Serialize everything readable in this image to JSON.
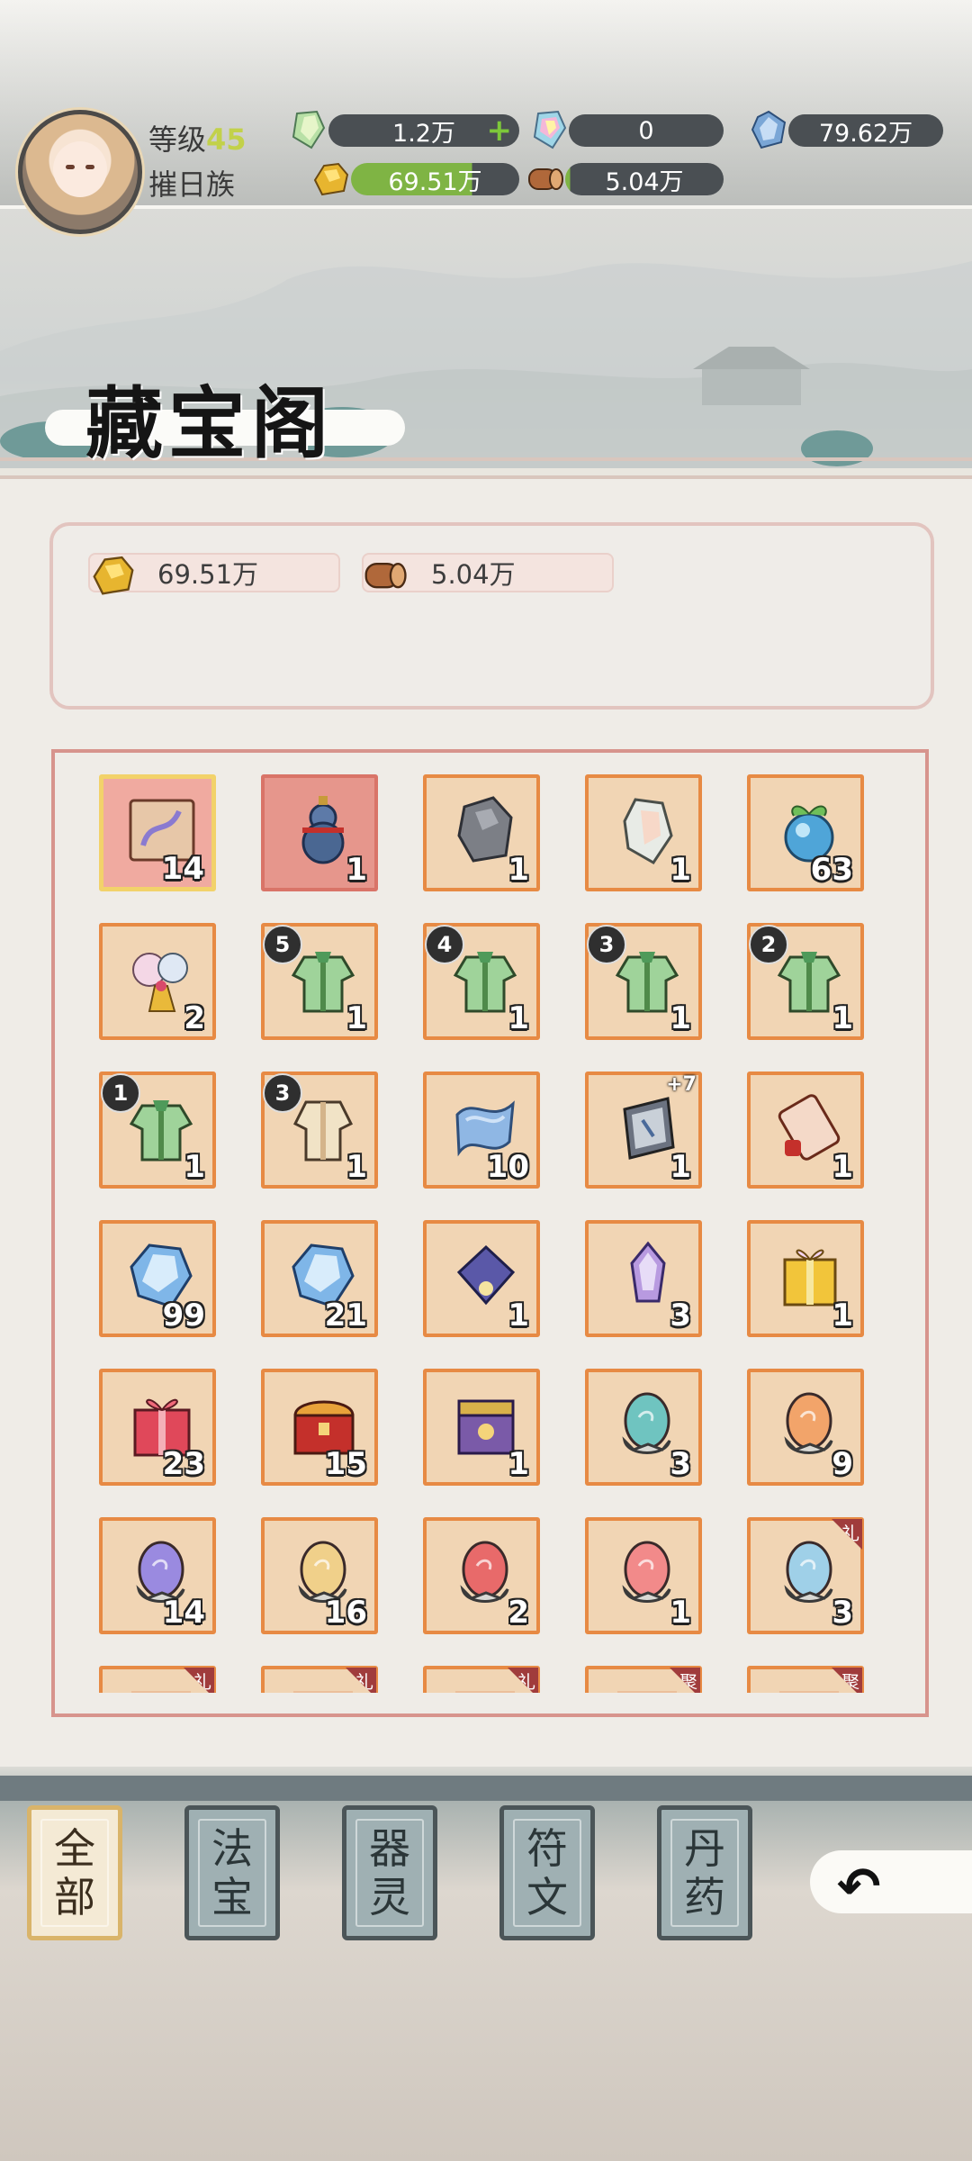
{
  "header": {
    "level_label": "等级",
    "level_value": "45",
    "clan_name": "摧日族",
    "resources": [
      {
        "name": "spirit-crystal",
        "value": "1.2万"
      },
      {
        "name": "rainbow-crystal",
        "value": "0"
      },
      {
        "name": "blue-gem",
        "value": "79.62万"
      },
      {
        "name": "gold-ore",
        "value": "69.51万"
      },
      {
        "name": "wood",
        "value": "5.04万"
      }
    ]
  },
  "page": {
    "title": "藏宝阁",
    "summary": [
      {
        "name": "gold-ore",
        "value": "69.51万"
      },
      {
        "name": "wood",
        "value": "5.04万"
      }
    ]
  },
  "items": [
    {
      "icon": "map-scroll-icon",
      "count": "14"
    },
    {
      "icon": "gourd-icon",
      "count": "1"
    },
    {
      "icon": "stone-icon",
      "count": "1"
    },
    {
      "icon": "crystal-shard-icon",
      "count": "1"
    },
    {
      "icon": "spirit-fruit-icon",
      "count": "63"
    },
    {
      "icon": "flower-bundle-icon",
      "count": "2"
    },
    {
      "icon": "robe-icon",
      "count": "1",
      "badge": "5"
    },
    {
      "icon": "robe-icon",
      "count": "1",
      "badge": "4"
    },
    {
      "icon": "robe-icon",
      "count": "1",
      "badge": "3"
    },
    {
      "icon": "robe-icon",
      "count": "1",
      "badge": "2"
    },
    {
      "icon": "robe-icon",
      "count": "1",
      "badge": "1"
    },
    {
      "icon": "cloth-robe-icon",
      "count": "1",
      "badge": "3"
    },
    {
      "icon": "silk-cloth-icon",
      "count": "10"
    },
    {
      "icon": "talisman-icon",
      "count": "1",
      "plus": "+7"
    },
    {
      "icon": "scroll-icon",
      "count": "1"
    },
    {
      "icon": "ice-crystal-icon",
      "count": "99"
    },
    {
      "icon": "ice-crystal-icon",
      "count": "21"
    },
    {
      "icon": "purple-fan-icon",
      "count": "1"
    },
    {
      "icon": "purple-crystal-icon",
      "count": "3"
    },
    {
      "icon": "gold-gift-box-icon",
      "count": "1"
    },
    {
      "icon": "red-gift-box-icon",
      "count": "23"
    },
    {
      "icon": "treasure-chest-icon",
      "count": "15"
    },
    {
      "icon": "purple-chest-icon",
      "count": "1"
    },
    {
      "icon": "teal-egg-icon",
      "count": "3"
    },
    {
      "icon": "orange-egg-icon",
      "count": "9"
    },
    {
      "icon": "purple-egg-icon",
      "count": "14"
    },
    {
      "icon": "yellow-egg-icon",
      "count": "16"
    },
    {
      "icon": "red-egg-icon",
      "count": "2"
    },
    {
      "icon": "pink-egg-icon",
      "count": "1"
    },
    {
      "icon": "rainbow-egg-icon",
      "count": "3",
      "gift": "礼"
    },
    {
      "icon": "partial-item-icon",
      "count": "",
      "gift": "礼"
    },
    {
      "icon": "partial-item-icon",
      "count": "",
      "gift": "礼"
    },
    {
      "icon": "partial-item-icon",
      "count": "",
      "gift": "礼"
    },
    {
      "icon": "partial-item-icon",
      "count": "",
      "gift": "聚"
    },
    {
      "icon": "partial-item-icon",
      "count": "",
      "gift": "聚"
    }
  ],
  "tabs": [
    {
      "line1": "全",
      "line2": "部",
      "active": true
    },
    {
      "line1": "法",
      "line2": "宝",
      "active": false
    },
    {
      "line1": "器",
      "line2": "灵",
      "active": false
    },
    {
      "line1": "符",
      "line2": "文",
      "active": false
    },
    {
      "line1": "丹",
      "line2": "药",
      "active": false
    }
  ],
  "colors": {
    "slot_bg": "#f1d5b4",
    "slot_border": "#e78a44",
    "grid_frame": "#d7948d",
    "level_accent": "#c2d14a",
    "bar_fill_green": "#7fb444"
  }
}
